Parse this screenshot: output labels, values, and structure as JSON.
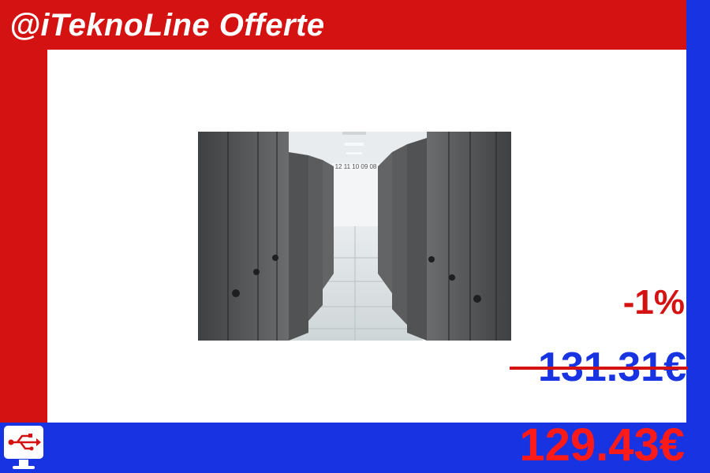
{
  "header": {
    "brand_title": "@iTeknoLine Offerte"
  },
  "product": {
    "image_alt": "server-room-aisle",
    "rack_numbers": "12 11 10 09 08"
  },
  "pricing": {
    "discount": "-1%",
    "old_price": "131.31€",
    "new_price": "129.43€"
  },
  "colors": {
    "brand_red": "#d51212",
    "brand_blue": "#1733e2",
    "price_red": "#ff1a1a",
    "panel_white": "#ffffff"
  },
  "icons": {
    "logo": "usb-monitor-icon"
  }
}
